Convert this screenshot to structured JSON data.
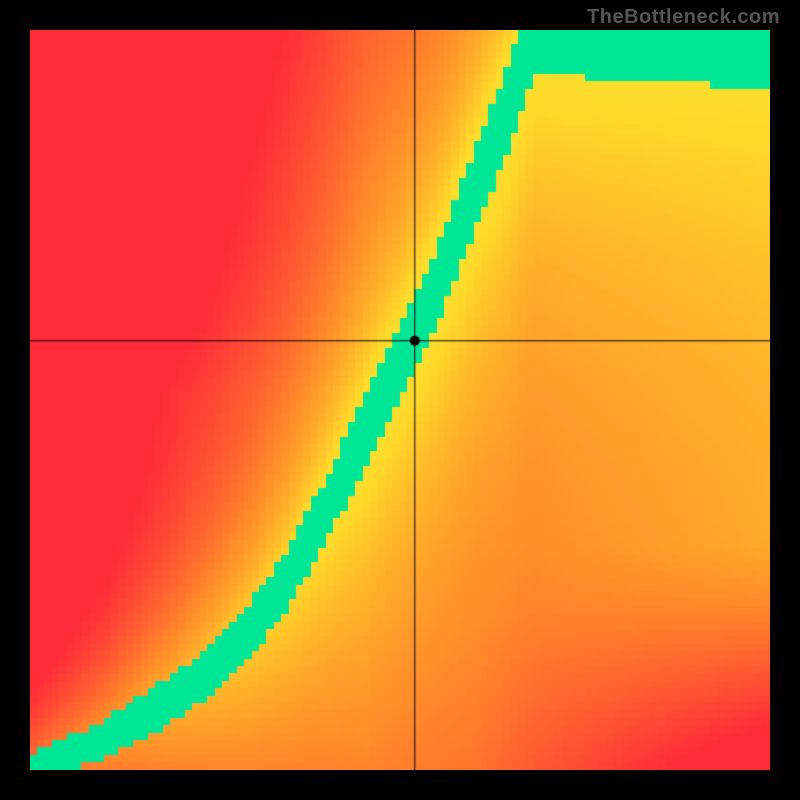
{
  "watermark": "TheBottleneck.com",
  "chart_data": {
    "type": "heatmap",
    "title": "",
    "xlabel": "",
    "ylabel": "",
    "xlim": [
      0,
      1
    ],
    "ylim": [
      0,
      1
    ],
    "crosshair": {
      "x": 0.52,
      "y": 0.58
    },
    "marker": {
      "x": 0.52,
      "y": 0.58
    },
    "ridge_curve": [
      [
        0.0,
        0.0
      ],
      [
        0.05,
        0.02
      ],
      [
        0.1,
        0.04
      ],
      [
        0.15,
        0.07
      ],
      [
        0.2,
        0.1
      ],
      [
        0.25,
        0.14
      ],
      [
        0.3,
        0.19
      ],
      [
        0.35,
        0.26
      ],
      [
        0.4,
        0.35
      ],
      [
        0.45,
        0.45
      ],
      [
        0.5,
        0.55
      ],
      [
        0.55,
        0.65
      ],
      [
        0.6,
        0.78
      ],
      [
        0.65,
        0.9
      ],
      [
        0.68,
        1.0
      ]
    ],
    "colorscale": {
      "low": "#ff2a3a",
      "mid_low": "#ff8a2a",
      "mid": "#ffd82a",
      "mid_high": "#e8f53a",
      "high": "#00e596"
    }
  }
}
